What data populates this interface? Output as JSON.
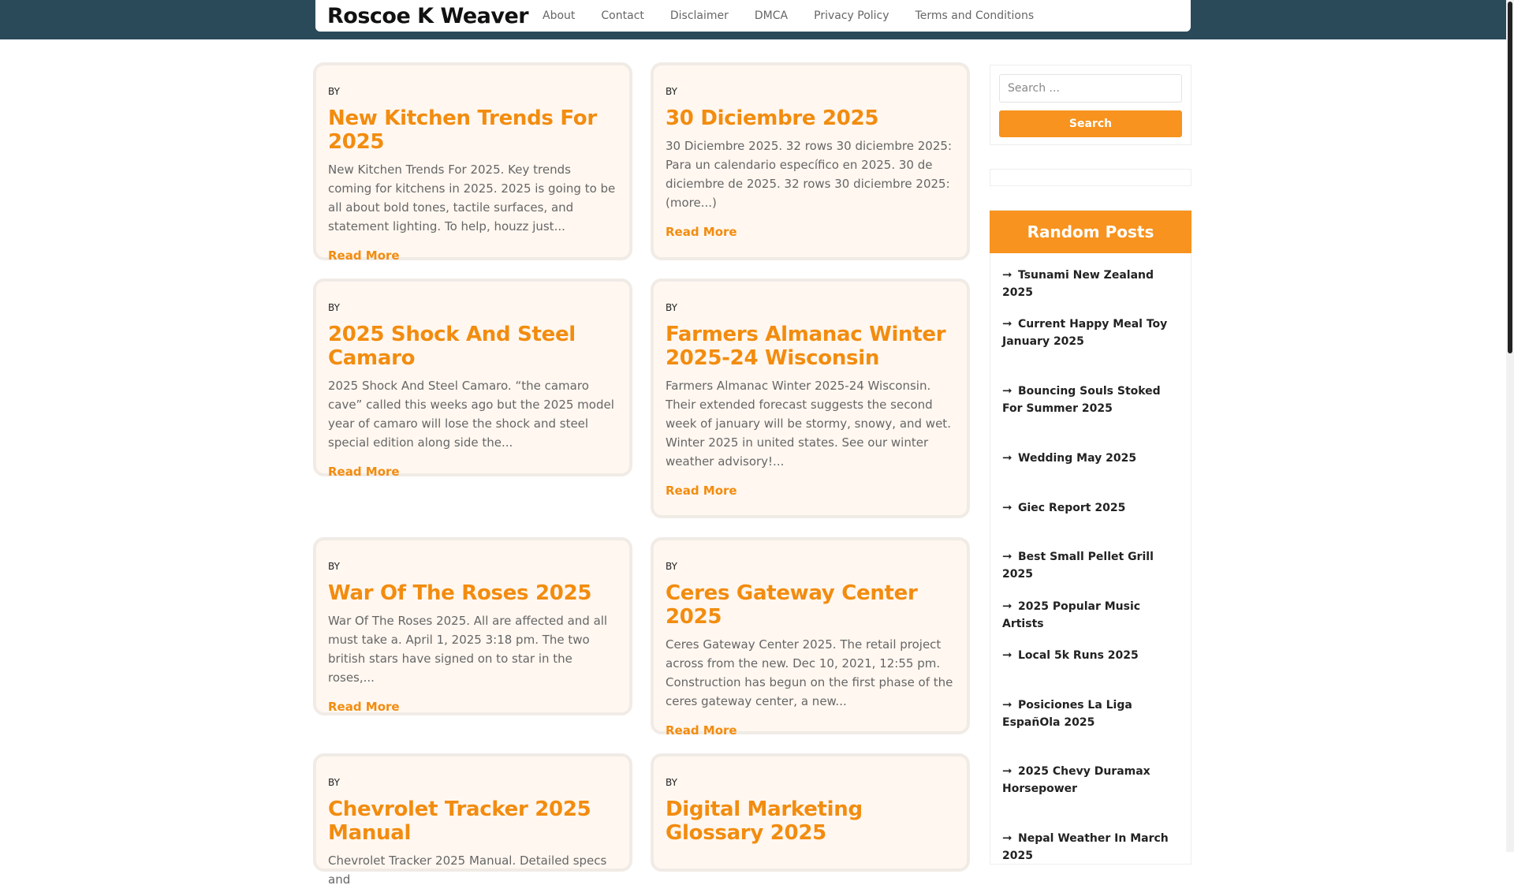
{
  "site": {
    "title": "Roscoe K Weaver"
  },
  "nav": {
    "items": [
      "About",
      "Contact",
      "Disclaimer",
      "DMCA",
      "Privacy Policy",
      "Terms and Conditions"
    ]
  },
  "posts": [
    {
      "by": "BY",
      "title": "New Kitchen Trends For 2025",
      "excerpt": "New Kitchen Trends For 2025. Key trends coming for kitchens in 2025. 2025 is going to be all about bold tones, tactile surfaces, and statement lighting. To help, houzz just...",
      "more": "Read More"
    },
    {
      "by": "BY",
      "title": "30 Diciembre 2025",
      "excerpt": "30 Diciembre 2025. 32 rows 30 diciembre 2025: Para un calendario específico en 2025. 30 de diciembre de 2025. 32 rows 30 diciembre 2025: (more...)",
      "more": "Read More"
    },
    {
      "by": "BY",
      "title": "2025 Shock And Steel Camaro",
      "excerpt": "2025 Shock And Steel Camaro. “the camaro cave” called this weeks ago but the 2025 model year of camaro will lose the shock and steel special edition along side the...",
      "more": "Read More"
    },
    {
      "by": "BY",
      "title": "Farmers Almanac Winter 2025-24 Wisconsin",
      "excerpt": "Farmers Almanac Winter 2025-24 Wisconsin. Their extended forecast suggests the second week of january will be stormy, snowy, and wet. Winter 2025 in united states. See our winter weather advisory!...",
      "more": "Read More"
    },
    {
      "by": "BY",
      "title": "War Of The Roses 2025",
      "excerpt": "War Of The Roses 2025. All are affected and all must take a. April 1, 2025 3:18 pm. The two british stars have signed on to star in the roses,...",
      "more": "Read More"
    },
    {
      "by": "BY",
      "title": "Ceres Gateway Center 2025",
      "excerpt": "Ceres Gateway Center 2025. The retail project across from the new. Dec 10, 2021, 12:55 pm. Construction has begun on the first phase of the ceres gateway center, a new...",
      "more": "Read More"
    },
    {
      "by": "BY",
      "title": "Chevrolet Tracker 2025 Manual",
      "excerpt": "Chevrolet Tracker 2025 Manual. Detailed specs and",
      "more": ""
    },
    {
      "by": "BY",
      "title": "Digital Marketing Glossary 2025",
      "excerpt": "",
      "more": ""
    }
  ],
  "search": {
    "placeholder": "Search ...",
    "button": "Search"
  },
  "random_posts": {
    "heading": "Random Posts",
    "items": [
      "Tsunami New Zealand 2025",
      "Current Happy Meal Toy January 2025",
      "Bouncing Souls Stoked For Summer 2025",
      "Wedding May 2025",
      "Giec Report 2025",
      "Best Small Pellet Grill 2025",
      "2025 Popular Music Artists",
      "Local 5k Runs 2025",
      "Posiciones La Liga EspañOla 2025",
      "2025 Chevy Duramax Horsepower",
      "Nepal Weather In March 2025"
    ]
  },
  "colors": {
    "accent": "#f7931e",
    "title": "#f28c0f",
    "header_bg": "#2a4a59",
    "card_bg": "#fff7f0"
  }
}
